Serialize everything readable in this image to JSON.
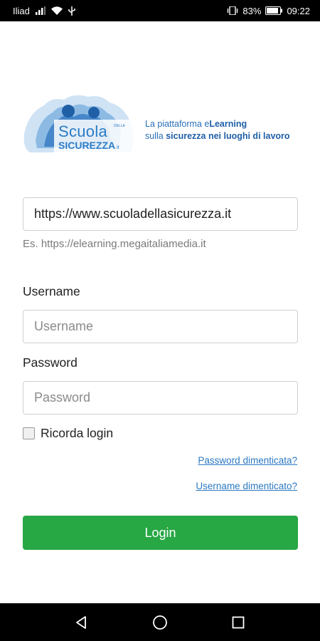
{
  "status_bar": {
    "carrier": "Iliad",
    "battery_percent": "83%",
    "time": "09:22",
    "icons": [
      "signal-icon",
      "wifi-icon",
      "usb-icon",
      "vibrate-icon",
      "battery-icon"
    ]
  },
  "logo": {
    "scuola": "Scuola",
    "della": "DELLA",
    "sicurezza": "SICUREZZA",
    "it": ".it",
    "tagline_line1_pre": "La piattaforma e",
    "tagline_line1_bold": "Learning",
    "tagline_line2_pre": "sulla ",
    "tagline_line2_bold": "sicurezza nei luoghi di lavoro",
    "brand_color": "#2a7cc7"
  },
  "form": {
    "url_value": "https://www.scuoladellasicurezza.it",
    "url_hint": "Es. https://elearning.megaitaliamedia.it",
    "username_label": "Username",
    "username_placeholder": "Username",
    "password_label": "Password",
    "password_placeholder": "Password",
    "remember_label": "Ricorda login",
    "remember_checked": false,
    "forgot_password": "Password dimenticata?",
    "forgot_username": "Username dimenticato?",
    "login_label": "Login",
    "login_color": "#28a745"
  },
  "navigation_bar": {
    "icons": [
      "back-icon",
      "home-icon",
      "recents-icon"
    ]
  }
}
